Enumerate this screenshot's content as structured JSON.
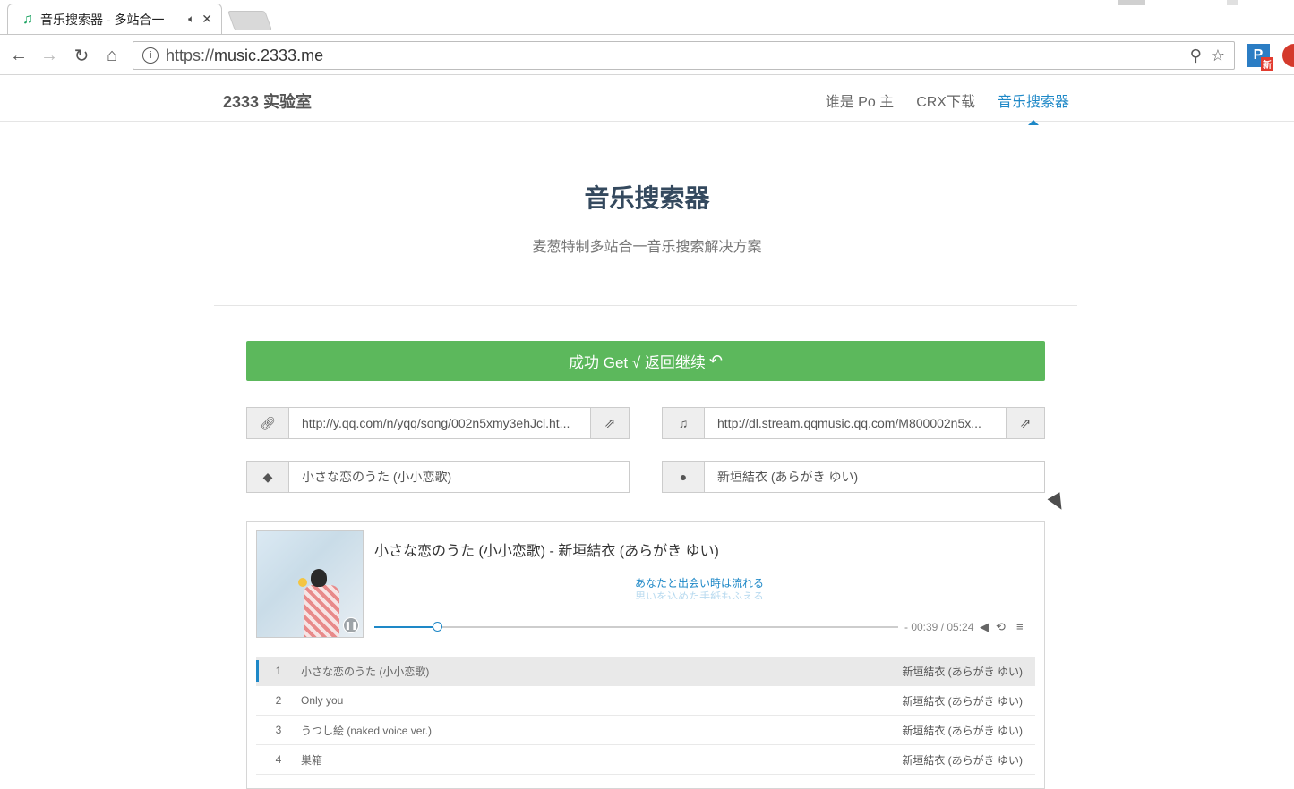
{
  "browser": {
    "tab_title": "音乐搜索器 - 多站合一",
    "url_scheme": "https://",
    "url_host": "music.2333.me",
    "extension_badge": "新",
    "extension_letter": "P"
  },
  "site": {
    "brand": "2333 实验室",
    "nav": [
      "谁是 Po 主",
      "CRX下载",
      "音乐搜索器"
    ],
    "active_nav": "音乐搜索器"
  },
  "hero": {
    "title": "音乐搜索器",
    "subtitle": "麦葱特制多站合一音乐搜索解决方案"
  },
  "success_button": {
    "label": "成功 Get √ 返回继续"
  },
  "fields": {
    "song_link": "http://y.qq.com/n/yqq/song/002n5xmy3ehJcl.ht...",
    "audio_link": "http://dl.stream.qqmusic.qq.com/M800002n5x...",
    "song_name": "小さな恋のうた (小小恋歌)",
    "artist_name": "新垣結衣 (あらがき ゆい)"
  },
  "player": {
    "now_playing": "小さな恋のうた (小小恋歌) - 新垣結衣 (あらがき ゆい)",
    "lyric_current": "あなたと出会い時は流れる",
    "lyric_next": "思いを込めた手紙もふえる",
    "time_display": "- 00:39 / 05:24",
    "progress_fraction": 0.1204,
    "accent_color": "#1e88c7"
  },
  "playlist": [
    {
      "num": "1",
      "name": "小さな恋のうた (小小恋歌)",
      "artist": "新垣結衣 (あらがき ゆい)",
      "active": true
    },
    {
      "num": "2",
      "name": "Only you",
      "artist": "新垣結衣 (あらがき ゆい)",
      "active": false
    },
    {
      "num": "3",
      "name": "うつし絵 (naked voice ver.)",
      "artist": "新垣結衣 (あらがき ゆい)",
      "active": false
    },
    {
      "num": "4",
      "name": "巣箱",
      "artist": "新垣結衣 (あらがき ゆい)",
      "active": false
    }
  ]
}
